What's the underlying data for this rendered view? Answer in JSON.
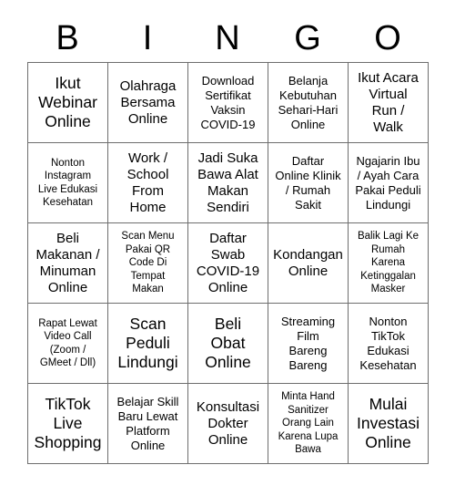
{
  "card": {
    "title": "BINGO",
    "header_letters": [
      "B",
      "I",
      "N",
      "G",
      "O"
    ],
    "columns": 5,
    "rows": 5,
    "colors": {
      "background": "#ffffff",
      "grid_line": "#6e6e6e",
      "text": "#000000"
    },
    "cells": [
      [
        {
          "text": "Ikut\nWebinar\nOnline",
          "size": "lg"
        },
        {
          "text": "Olahraga\nBersama\nOnline",
          "size": "md"
        },
        {
          "text": "Download\nSertifikat\nVaksin\nCOVID-19",
          "size": "sm"
        },
        {
          "text": "Belanja\nKebutuhan\nSehari-Hari\nOnline",
          "size": "sm"
        },
        {
          "text": "Ikut Acara\nVirtual\nRun /\nWalk",
          "size": "md"
        }
      ],
      [
        {
          "text": "Nonton\nInstagram\nLive Edukasi\nKesehatan",
          "size": "xs"
        },
        {
          "text": "Work /\nSchool\nFrom\nHome",
          "size": "md"
        },
        {
          "text": "Jadi Suka\nBawa Alat\nMakan\nSendiri",
          "size": "md"
        },
        {
          "text": "Daftar\nOnline Klinik\n/ Rumah\nSakit",
          "size": "sm"
        },
        {
          "text": "Ngajarin Ibu\n/ Ayah Cara\nPakai Peduli\nLindungi",
          "size": "sm"
        }
      ],
      [
        {
          "text": "Beli\nMakanan /\nMinuman\nOnline",
          "size": "md"
        },
        {
          "text": "Scan Menu\nPakai QR\nCode Di\nTempat\nMakan",
          "size": "xs"
        },
        {
          "text": "Daftar\nSwab\nCOVID-19\nOnline",
          "size": "md"
        },
        {
          "text": "Kondangan\nOnline",
          "size": "md"
        },
        {
          "text": "Balik Lagi Ke\nRumah\nKarena\nKetinggalan\nMasker",
          "size": "xs"
        }
      ],
      [
        {
          "text": "Rapat Lewat\nVideo Call\n(Zoom /\nGMeet / Dll)",
          "size": "xs"
        },
        {
          "text": "Scan\nPeduli\nLindungi",
          "size": "lg"
        },
        {
          "text": "Beli\nObat\nOnline",
          "size": "lg"
        },
        {
          "text": "Streaming\nFilm\nBareng\nBareng",
          "size": "sm"
        },
        {
          "text": "Nonton\nTikTok\nEdukasi\nKesehatan",
          "size": "sm"
        }
      ],
      [
        {
          "text": "TikTok\nLive\nShopping",
          "size": "lg"
        },
        {
          "text": "Belajar Skill\nBaru Lewat\nPlatform\nOnline",
          "size": "sm"
        },
        {
          "text": "Konsultasi\nDokter\nOnline",
          "size": "md"
        },
        {
          "text": "Minta Hand\nSanitizer\nOrang Lain\nKarena Lupa\nBawa",
          "size": "xs"
        },
        {
          "text": "Mulai\nInvestasi\nOnline",
          "size": "lg"
        }
      ]
    ]
  }
}
